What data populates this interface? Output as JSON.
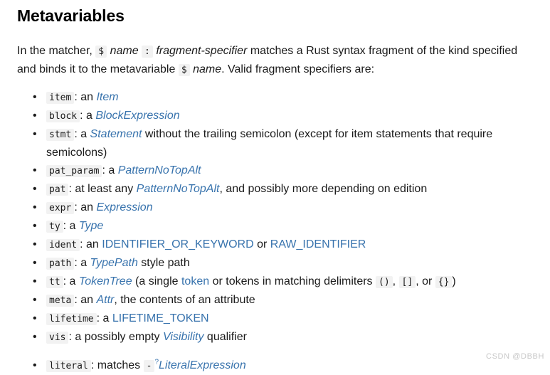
{
  "document": {
    "title": "Metavariables",
    "intro": {
      "part1": "In the matcher, ",
      "code_dollar": "$",
      "em_name": "name",
      "code_colon": ":",
      "em_fragment_specifier": "fragment-specifier",
      "part2": " matches a Rust syntax fragment of the kind specified and binds it to the metavariable ",
      "code_dollar2": "$",
      "em_name2": "name",
      "part3": ". Valid fragment specifiers are:"
    },
    "list": [
      {
        "code": "item",
        "sep": ": an ",
        "link": "Item",
        "link_italic": true,
        "tail": ""
      },
      {
        "code": "block",
        "sep": ": a ",
        "link": "BlockExpression",
        "link_italic": true,
        "tail": ""
      },
      {
        "code": "stmt",
        "sep": ": a ",
        "link": "Statement",
        "link_italic": true,
        "tail": " without the trailing semicolon (except for item statements that require semicolons)"
      },
      {
        "code": "pat_param",
        "sep": ": a ",
        "link": "PatternNoTopAlt",
        "link_italic": true,
        "tail": ""
      },
      {
        "code": "pat",
        "sep": ": at least any ",
        "link": "PatternNoTopAlt",
        "link_italic": true,
        "tail": ", and possibly more depending on edition"
      },
      {
        "code": "expr",
        "sep": ": an ",
        "link": "Expression",
        "link_italic": true,
        "tail": ""
      },
      {
        "code": "ty",
        "sep": ": a ",
        "link": "Type",
        "link_italic": true,
        "tail": ""
      },
      {
        "code": "ident",
        "sep": ": an ",
        "link": "IDENTIFIER_OR_KEYWORD",
        "link_italic": false,
        "mid": " or ",
        "link2": "RAW_IDENTIFIER",
        "link2_italic": false,
        "tail": ""
      },
      {
        "code": "path",
        "sep": ": a ",
        "link": "TypePath",
        "link_italic": true,
        "tail": " style path"
      },
      {
        "code": "tt",
        "sep": ": a ",
        "link": "TokenTree",
        "link_italic": true,
        "mid": " (a single ",
        "link2": "token",
        "link2_italic": false,
        "tail": " or tokens in matching delimiters ",
        "delims": {
          "paren": "()",
          "comma1": ", ",
          "bracket": "[]",
          "comma2": ", or ",
          "brace": "{}",
          "close": ")"
        }
      },
      {
        "code": "meta",
        "sep": ": an ",
        "link": "Attr",
        "link_italic": true,
        "tail": ", the contents of an attribute"
      },
      {
        "code": "lifetime",
        "sep": ": a ",
        "link": "LIFETIME_TOKEN",
        "link_italic": false,
        "tail": ""
      },
      {
        "code": "vis",
        "sep": ": a possibly empty ",
        "link": "Visibility",
        "link_italic": true,
        "tail": " qualifier"
      }
    ],
    "last_item": {
      "code": "literal",
      "sep": ": matches ",
      "code_minus": "-",
      "sup": "?",
      "link": "LiteralExpression"
    },
    "watermark": "CSDN @DBBH",
    "colors": {
      "link": "#3873ad",
      "code_bg": "#f2f2f2",
      "text": "#1a1a1a",
      "watermark": "#c8c8c8"
    }
  }
}
